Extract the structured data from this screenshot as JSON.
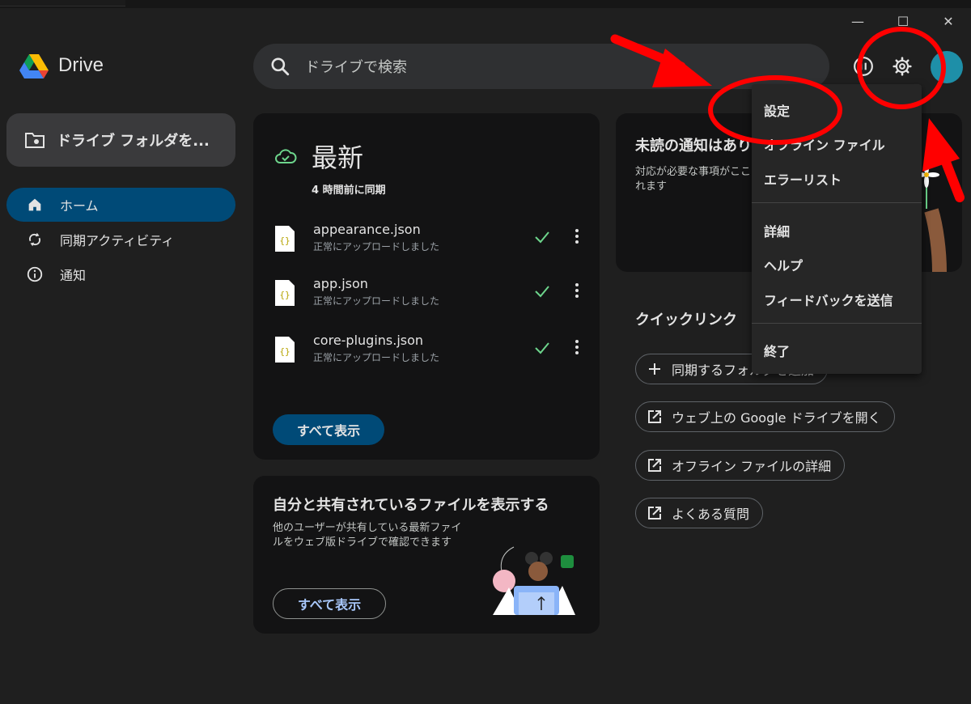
{
  "app": {
    "name": "Drive"
  },
  "window_controls": {
    "minimize": "—",
    "maximize": "☐",
    "close": "✕"
  },
  "search": {
    "placeholder": "ドライブで検索"
  },
  "sidebar": {
    "folder_button": "ドライブ フォルダを...",
    "items": [
      {
        "label": "ホーム",
        "icon": "home-icon",
        "active": true
      },
      {
        "label": "同期アクティビティ",
        "icon": "sync-icon",
        "active": false
      },
      {
        "label": "通知",
        "icon": "info-icon",
        "active": false
      }
    ]
  },
  "recent": {
    "title": "最新",
    "subtitle": "4 時間前に同期",
    "files": [
      {
        "name": "appearance.json",
        "status": "正常にアップロードしました"
      },
      {
        "name": "app.json",
        "status": "正常にアップロードしました"
      },
      {
        "name": "core-plugins.json",
        "status": "正常にアップロードしました"
      }
    ],
    "show_all": "すべて表示"
  },
  "shared": {
    "title": "自分と共有されているファイルを表示する",
    "description": "他のユーザーが共有している最新ファイルをウェブ版ドライブで確認できます",
    "show_all": "すべて表示"
  },
  "notifications": {
    "title": "未読の通知はありません",
    "description": "対応が必要な事項がここに表示されます"
  },
  "quick_links": {
    "title": "クイックリンク",
    "items": [
      {
        "label": "同期するフォルダを追加",
        "icon": "plus-icon"
      },
      {
        "label": "ウェブ上の Google ドライブを開く",
        "icon": "open-external-icon"
      },
      {
        "label": "オフライン ファイルの詳細",
        "icon": "open-external-icon"
      },
      {
        "label": "よくある質問",
        "icon": "open-external-icon"
      }
    ]
  },
  "settings_menu": {
    "items": [
      "設定",
      "オフライン ファイル",
      "エラーリスト",
      "詳細",
      "ヘルプ",
      "フィードバックを送信",
      "終了"
    ]
  },
  "colors": {
    "annotation": "#ff0000",
    "accent": "#004a77",
    "sync_green": "#6dd58c"
  }
}
